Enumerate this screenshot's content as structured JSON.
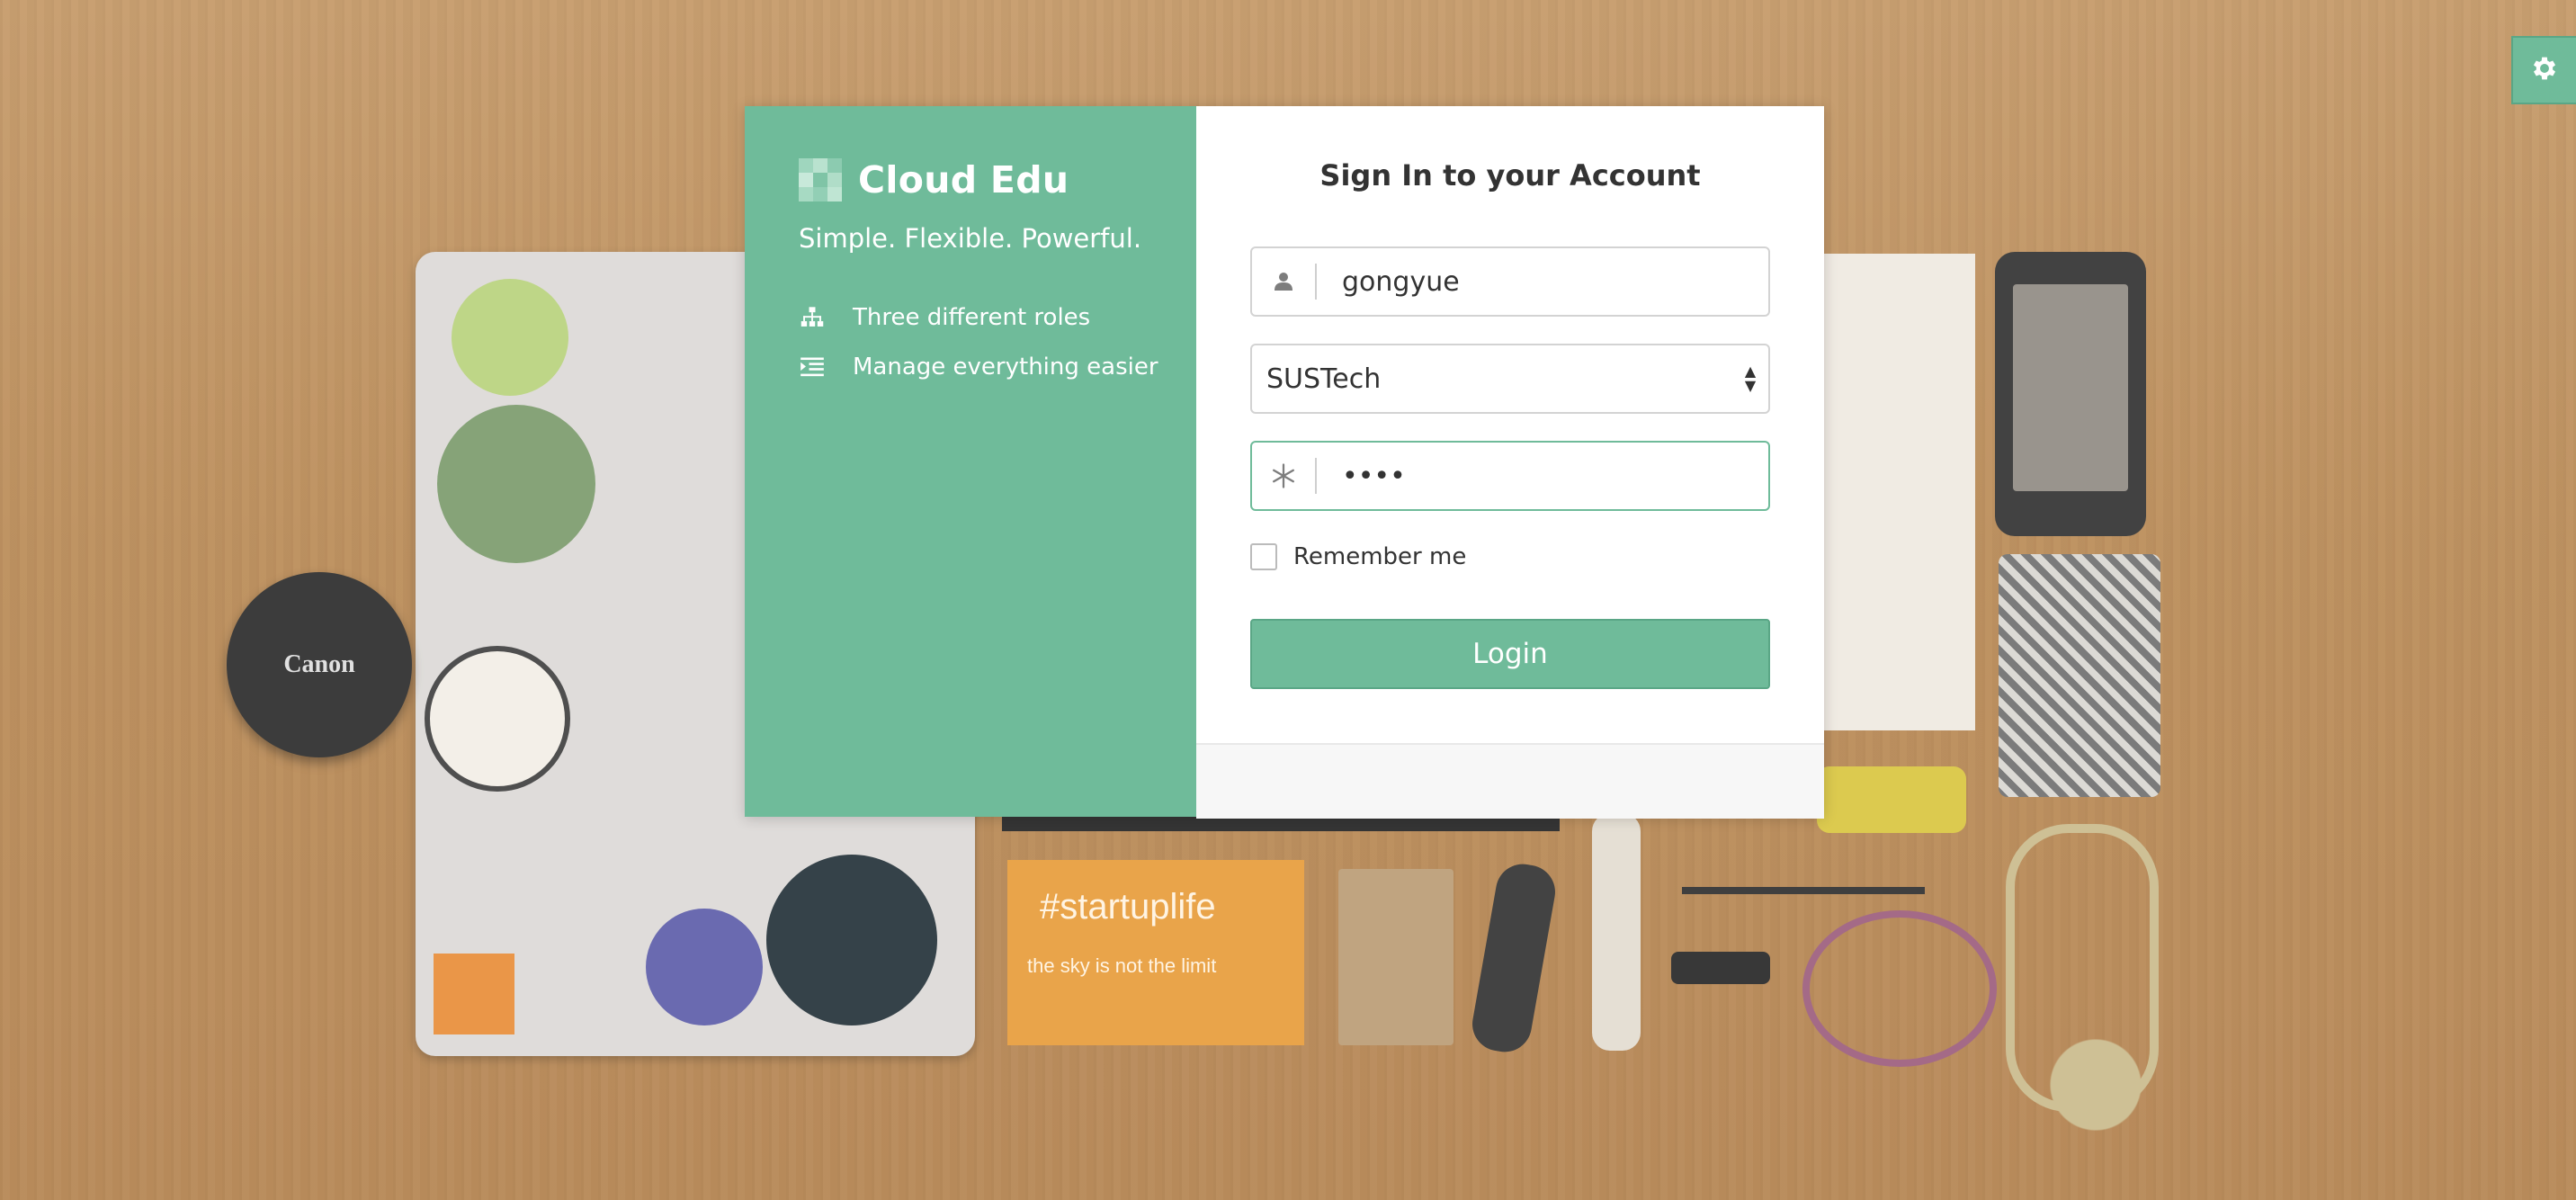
{
  "brand": {
    "name": "Cloud Edu",
    "tagline": "Simple. Flexible. Powerful.",
    "logo_colors": [
      "#9fd6be",
      "#b9e2cf",
      "#8ccbb0",
      "#c8e9da",
      "#7fc4a6",
      "#b0ddc8",
      "#a7dac3",
      "#92cfb5",
      "#bfe5d3"
    ]
  },
  "features": [
    {
      "icon": "sitemap-icon",
      "label": "Three different roles"
    },
    {
      "icon": "indent-list-icon",
      "label": "Manage everything easier"
    }
  ],
  "form": {
    "title": "Sign In to your Account",
    "username": {
      "icon": "user-icon",
      "value": "gongyue"
    },
    "school": {
      "selected": "SUSTech"
    },
    "password": {
      "icon": "asterisk-icon",
      "value": "••••"
    },
    "remember_label": "Remember me",
    "remember_checked": false,
    "login_label": "Login"
  },
  "settings": {
    "icon": "gear-icon"
  },
  "background": {
    "lens_text": "Canon",
    "card_text_1": "#startuplife",
    "card_text_2": "the sky is not the limit"
  },
  "colors": {
    "accent": "#6fbb9a",
    "accent_border": "#5aa686",
    "panel_right": "#ffffff",
    "text": "#333333"
  }
}
